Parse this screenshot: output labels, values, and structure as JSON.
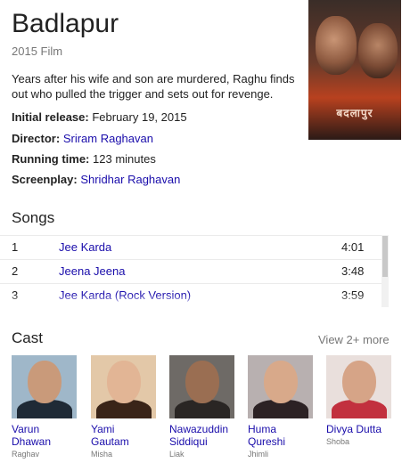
{
  "film": {
    "title": "Badlapur",
    "subtitle": "2015 Film",
    "description": "Years after his wife and son are murdered, Raghu finds out who pulled the trigger and sets out for revenge.",
    "poster_text": "बदलापुर"
  },
  "facts": [
    {
      "label": "Initial release:",
      "value": "February 19, 2015",
      "link": false
    },
    {
      "label": "Director:",
      "value": "Sriram Raghavan",
      "link": true
    },
    {
      "label": "Running time:",
      "value": "123 minutes",
      "link": false
    },
    {
      "label": "Screenplay:",
      "value": "Shridhar Raghavan",
      "link": true
    }
  ],
  "songs": {
    "heading": "Songs",
    "items": [
      {
        "num": "1",
        "name": "Jee Karda",
        "duration": "4:01"
      },
      {
        "num": "2",
        "name": "Jeena Jeena",
        "duration": "3:48"
      },
      {
        "num": "3",
        "name": "Jee Karda (Rock Version)",
        "duration": "3:59"
      }
    ]
  },
  "cast": {
    "heading": "Cast",
    "more_label": "View 2+ more",
    "members": [
      {
        "name_line1": "Varun",
        "name_line2": "Dhawan",
        "role": "Raghav",
        "bg": "#9fb7c9",
        "skin": "#c99a7a",
        "shirt": "#1f2a36"
      },
      {
        "name_line1": "Yami",
        "name_line2": "Gautam",
        "role": "Misha",
        "bg": "#e3c8a8",
        "skin": "#e2b595",
        "shirt": "#3a2418"
      },
      {
        "name_line1": "Nawazuddin",
        "name_line2": "Siddiqui",
        "role": "Liak",
        "bg": "#6e6a66",
        "skin": "#9a6e52",
        "shirt": "#2a2624"
      },
      {
        "name_line1": "Huma",
        "name_line2": "Qureshi",
        "role": "Jhimli",
        "bg": "#b8b0b0",
        "skin": "#d8a98a",
        "shirt": "#2c2224"
      },
      {
        "name_line1": "Divya Dutta",
        "name_line2": "",
        "role": "Shoba",
        "bg": "#e9dfdc",
        "skin": "#d6a487",
        "shirt": "#c2303e"
      }
    ]
  }
}
